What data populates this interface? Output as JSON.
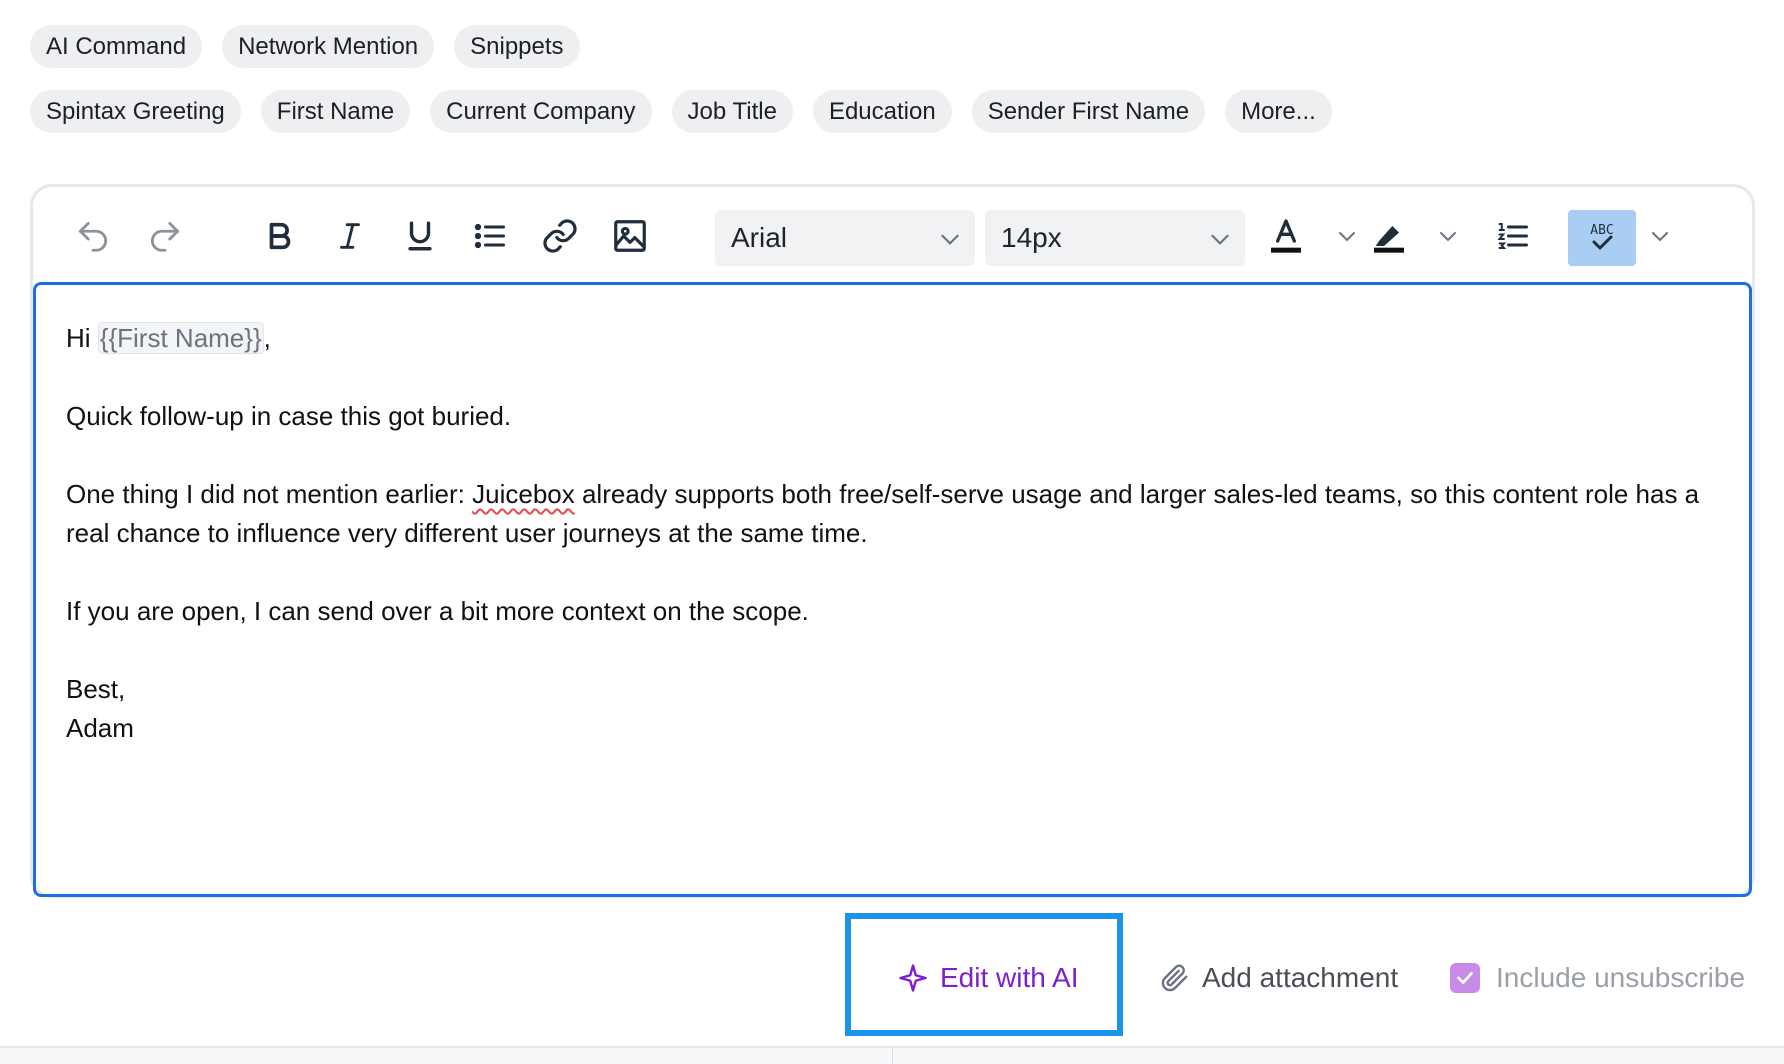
{
  "chips_row1": [
    "AI Command",
    "Network Mention",
    "Snippets"
  ],
  "chips_row2": [
    "Spintax Greeting",
    "First Name",
    "Current Company",
    "Job Title",
    "Education",
    "Sender First Name",
    "More..."
  ],
  "toolbar": {
    "font_family": "Arial",
    "font_size": "14px",
    "icons": [
      "undo-icon",
      "redo-icon",
      "bold-icon",
      "italic-icon",
      "underline-icon",
      "bullet-list-icon",
      "link-icon",
      "image-icon",
      "text-color-icon",
      "highlight-icon",
      "numbered-list-icon",
      "spellcheck-icon"
    ],
    "spellcheck_label": "ABC"
  },
  "email_body": {
    "greeting_prefix": "Hi ",
    "greeting_variable": "{{First Name}}",
    "greeting_suffix": ",",
    "line1": "Quick follow-up in case this got buried.",
    "p2_before": "One thing I did not mention earlier: ",
    "p2_misspelled": "Juicebox",
    "p2_after": " already supports both free/self-serve usage and larger sales-led teams, so this content role has a real chance to influence very different user journeys at the same time.",
    "line3": "If you are open, I can send over a bit more context on the scope.",
    "signoff": "Best,",
    "signature": "Adam"
  },
  "footer": {
    "edit_ai_label": "Edit with AI",
    "attachment_label": "Add attachment",
    "unsubscribe_label": "Include unsubscribe",
    "unsubscribe_checked": true
  },
  "colors": {
    "accent_blue": "#1e6fe0",
    "ai_purple": "#7b1fcf",
    "highlight_box": "#1b93e8",
    "checkbox_purple": "#c88be6",
    "chip_bg": "#eeeff0"
  }
}
